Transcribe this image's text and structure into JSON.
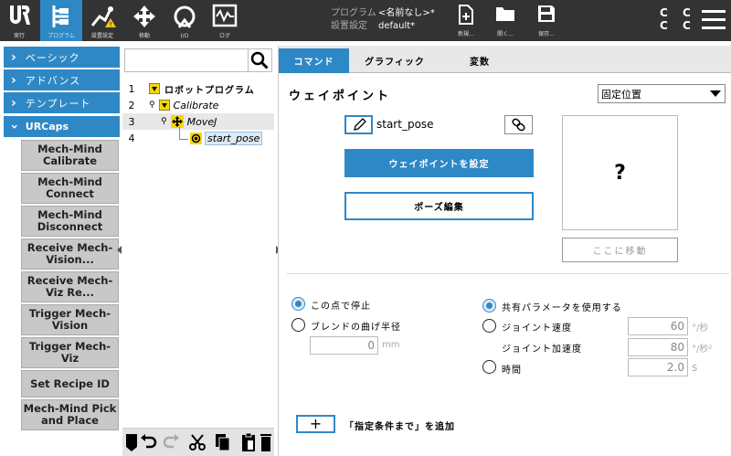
{
  "topbar": {
    "nav": [
      {
        "label": "実行",
        "icon": "ur-logo-icon"
      },
      {
        "label": "プログラム",
        "icon": "program-icon"
      },
      {
        "label": "設置設定",
        "icon": "installation-icon"
      },
      {
        "label": "移動",
        "icon": "move-icon"
      },
      {
        "label": "I/O",
        "icon": "io-icon"
      },
      {
        "label": "ログ",
        "icon": "log-icon"
      }
    ],
    "program_key": "プログラム",
    "program_value": "<名前なし>*",
    "install_key": "設置設定",
    "install_value": "default*",
    "tools": [
      {
        "label": "新規...",
        "icon": "new-file-icon"
      },
      {
        "label": "開く...",
        "icon": "open-folder-icon"
      },
      {
        "label": "保存...",
        "icon": "save-icon"
      }
    ],
    "cc_text": "C C C C"
  },
  "sidebar": {
    "sections": [
      {
        "label": "ベーシック"
      },
      {
        "label": "アドバンス"
      },
      {
        "label": "テンプレート"
      },
      {
        "label": "URCaps"
      }
    ],
    "urcaps": [
      {
        "label": "Mech-Mind Calibrate"
      },
      {
        "label": "Mech-Mind Connect"
      },
      {
        "label": "Mech-Mind Disconnect"
      },
      {
        "label": "Receive Mech-Vision..."
      },
      {
        "label": "Receive Mech-Viz Re..."
      },
      {
        "label": "Trigger Mech-Vision"
      },
      {
        "label": "Trigger Mech-Viz"
      },
      {
        "label": "Set Recipe ID"
      },
      {
        "label": "Mech-Mind Pick and Place"
      }
    ]
  },
  "tree": {
    "rows": [
      {
        "num": "1",
        "label": "ロボットプログラム"
      },
      {
        "num": "2",
        "label": "Calibrate"
      },
      {
        "num": "3",
        "label": "MoveJ"
      },
      {
        "num": "4",
        "label": "start_pose"
      }
    ]
  },
  "tabs": [
    {
      "label": "コマンド",
      "active": true
    },
    {
      "label": "グラフィック",
      "active": false
    },
    {
      "label": "変数",
      "active": false
    }
  ],
  "waypoint": {
    "title": "ウェイポイント",
    "position_mode": "固定位置",
    "name": "start_pose",
    "set_button": "ウェイポイントを設定",
    "edit_pose_button": "ポーズ編集",
    "preview_text": "?",
    "move_here_button": "ここに移動"
  },
  "options": {
    "stop_here": "この点で停止",
    "blend_radius": "ブレンドの曲げ半径",
    "blend_value": "0",
    "blend_unit": "mm",
    "shared_params": "共有パラメータを使用する",
    "joint_speed": "ジョイント速度",
    "joint_speed_value": "60",
    "joint_speed_unit": "°/秒",
    "joint_accel": "ジョイント加速度",
    "joint_accel_value": "80",
    "joint_accel_unit": "°/秒²",
    "time": "時間",
    "time_value": "2.0",
    "time_unit": "s"
  },
  "add_until": {
    "plus": "+",
    "label": "「指定条件まで」を追加"
  },
  "colors": {
    "accent": "#2f88c6",
    "topbar": "#333333",
    "selected_tree": "#dce9f5"
  }
}
